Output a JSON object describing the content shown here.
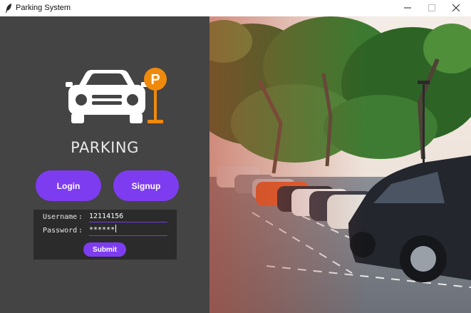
{
  "window": {
    "title": "Parking System",
    "controls": [
      "minimize-icon",
      "maximize-icon",
      "close-icon"
    ]
  },
  "brand": {
    "text": "PARKING",
    "badge_letter": "P",
    "icon": "car-parking-logo-icon"
  },
  "buttons": {
    "login_label": "Login",
    "signup_label": "Signup"
  },
  "form": {
    "username_label": "Username",
    "password_label": "Password",
    "separator": ":",
    "username_value": "12114156",
    "password_value": "******",
    "submit_label": "Submit"
  },
  "colors": {
    "panel_bg": "#444444",
    "form_bg": "#2b2b2b",
    "accent": "#7e3cf1",
    "badge_orange": "#f08a0c"
  },
  "photo": {
    "subject": "parking-lot-photo"
  }
}
